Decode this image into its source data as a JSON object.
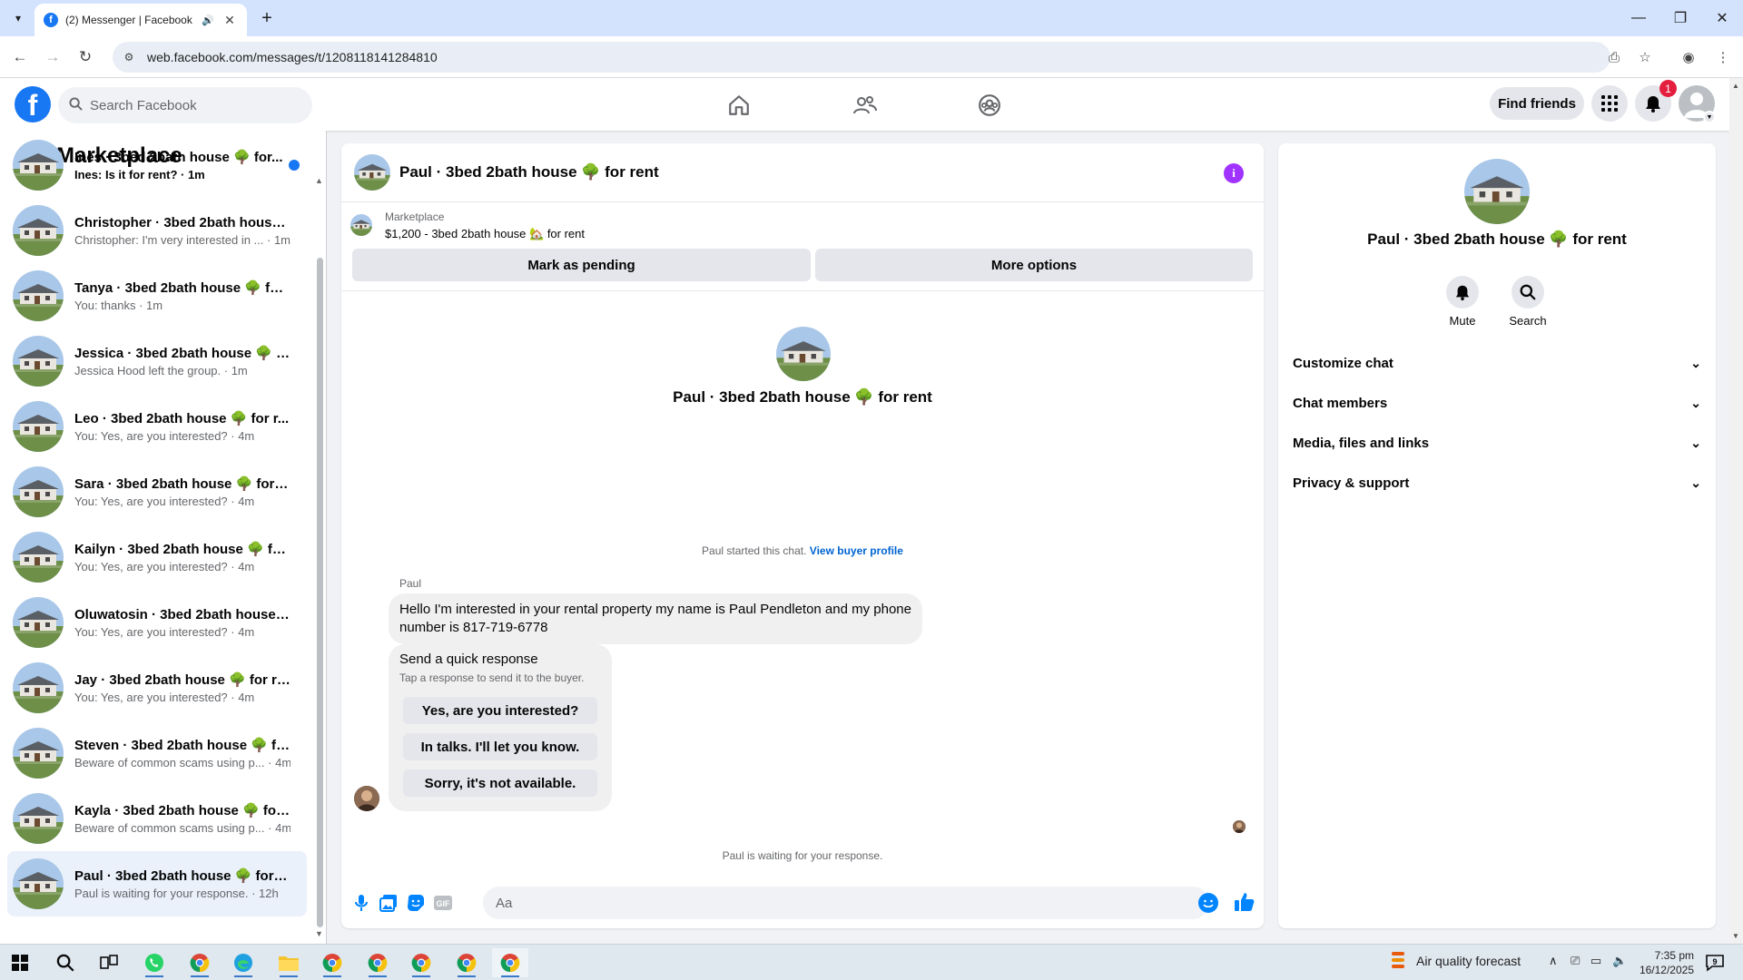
{
  "browser": {
    "tab_title": "(2) Messenger | Facebook",
    "favicon_letter": "f",
    "url": "web.facebook.com/messages/t/1208118141284810",
    "new_tab_symbol": "+"
  },
  "fb_header": {
    "search_placeholder": "Search Facebook",
    "find_friends_label": "Find friends",
    "notification_count": "1",
    "logo_letter": "f"
  },
  "sidebar": {
    "title": "Marketplace",
    "conversations": [
      {
        "name": "Ines · 3bed 2bath house 🌳 for...",
        "snippet": "Ines: Is it for rent? · 1m",
        "unread": true
      },
      {
        "name": "Christopher · 3bed 2bath house ...",
        "snippet": "Christopher: I'm very interested in ... · 1m"
      },
      {
        "name": "Tanya · 3bed 2bath house 🌳 for...",
        "snippet": "You: thanks · 1m"
      },
      {
        "name": "Jessica · 3bed 2bath house 🌳 fo...",
        "snippet": "Jessica Hood left the group. · 1m"
      },
      {
        "name": "Leo · 3bed 2bath house 🌳 for r...",
        "snippet": "You: Yes, are you interested? · 4m"
      },
      {
        "name": "Sara · 3bed 2bath house 🌳 for r...",
        "snippet": "You: Yes, are you interested? · 4m"
      },
      {
        "name": "Kailyn · 3bed 2bath house 🌳 fo...",
        "snippet": "You: Yes, are you interested? · 4m"
      },
      {
        "name": "Oluwatosin · 3bed 2bath house ...",
        "snippet": "You: Yes, are you interested? · 4m"
      },
      {
        "name": "Jay · 3bed 2bath house 🌳 for re...",
        "snippet": "You: Yes, are you interested? · 4m"
      },
      {
        "name": "Steven · 3bed 2bath house 🌳 fo...",
        "snippet": "Beware of common scams using p... · 4m"
      },
      {
        "name": "Kayla · 3bed 2bath house 🌳 for...",
        "snippet": "Beware of common scams using p... · 4m"
      },
      {
        "name": "Paul · 3bed 2bath house 🌳 for r...",
        "snippet": "Paul is waiting for your response. · 12h",
        "active": true
      }
    ]
  },
  "chat": {
    "title": "Paul · 3bed 2bath house 🌳 for rent",
    "listing_label": "Marketplace",
    "listing_price": "$1,200 - 3bed 2bath house 🏡 for rent",
    "mark_pending_label": "Mark as pending",
    "more_options_label": "More options",
    "intro_title": "Paul · 3bed 2bath house 🌳 for rent",
    "started_text": "Paul started this chat.",
    "view_profile_link": "View buyer profile",
    "sender_name": "Paul",
    "message_text": "Hello I'm interested in your rental property my name is Paul Pendleton and my phone number is 817-719-6778",
    "quick_title": "Send a quick response",
    "quick_subtitle": "Tap a response to send it to the buyer.",
    "quick_responses": [
      "Yes, are you interested?",
      "In talks. I'll let you know.",
      "Sorry, it's not available."
    ],
    "waiting_text": "Paul is waiting for your response.",
    "composer_placeholder": "Aa"
  },
  "right_panel": {
    "title": "Paul · 3bed 2bath house 🌳 for rent",
    "mute_label": "Mute",
    "search_label": "Search",
    "sections": [
      "Customize chat",
      "Chat members",
      "Media, files and links",
      "Privacy & support"
    ]
  },
  "taskbar": {
    "weather_text": "Air quality forecast",
    "time": "7:35 pm",
    "date": "16/12/2025",
    "notification_count": "9"
  },
  "colors": {
    "fb_blue": "#1877f2",
    "messenger_blue": "#0084ff",
    "info_purple": "#a033ff",
    "badge_red": "#e41e3f"
  }
}
